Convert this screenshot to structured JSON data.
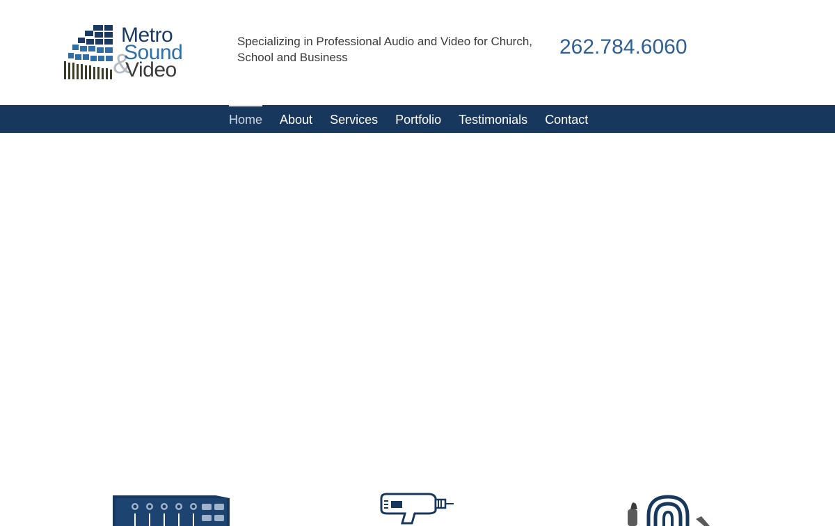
{
  "brand": {
    "name_line1": "Metro",
    "name_line2": "Sound",
    "name_amp": "&",
    "name_line3": "Video",
    "colors": {
      "navy": "#18375c",
      "blue": "#2f6fa6",
      "gray": "#b5bcc4",
      "dark": "#3b3b3b"
    }
  },
  "header": {
    "tagline": "Specializing in Professional Audio and Video for Church, School and Business",
    "phone": "262.784.6060"
  },
  "nav": {
    "items": [
      {
        "label": "Home",
        "active": true
      },
      {
        "label": "About",
        "active": false
      },
      {
        "label": "Services",
        "active": false
      },
      {
        "label": "Portfolio",
        "active": false
      },
      {
        "label": "Testimonials",
        "active": false
      },
      {
        "label": "Contact",
        "active": false
      }
    ]
  },
  "features": {
    "icons": [
      "mixer-icon",
      "drill-icon",
      "cable-icon"
    ]
  }
}
